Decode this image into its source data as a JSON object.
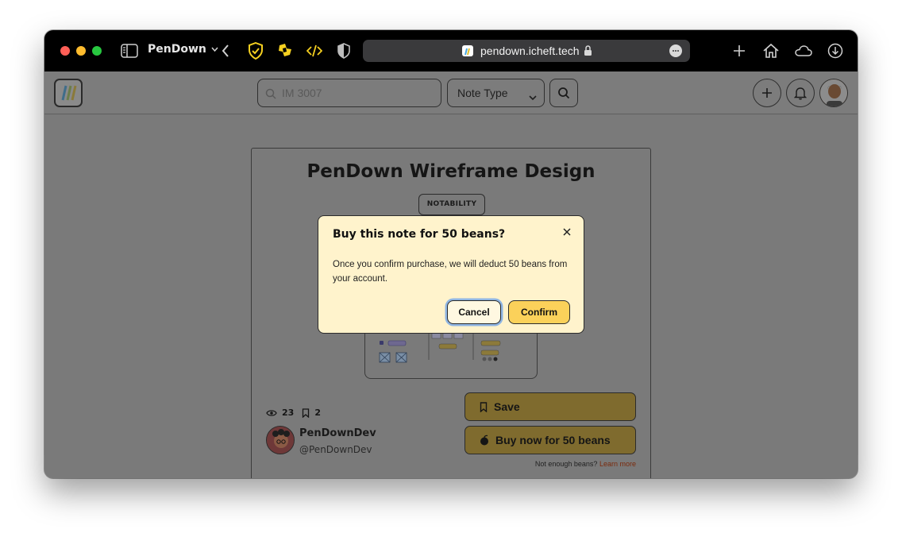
{
  "browser": {
    "tab_title": "PenDown",
    "url": "pendown.icheft.tech"
  },
  "header": {
    "search_placeholder": "IM 3007",
    "note_type_label": "Note Type"
  },
  "note": {
    "title": "PenDown Wireframe Design",
    "tag": "NOTABILITY",
    "views": "23",
    "saves": "2",
    "author_name": "PenDownDev",
    "author_handle": "@PenDownDev",
    "save_label": "Save",
    "buy_label": "Buy now for 50 beans",
    "beans_note": "Not enough beans?",
    "learn_more": "Learn more"
  },
  "modal": {
    "title": "Buy this note for 50 beans?",
    "body": "Once you confirm purchase, we will deduct 50 beans from your account.",
    "cancel_label": "Cancel",
    "confirm_label": "Confirm"
  },
  "colors": {
    "accent": "#fbd15a",
    "modal_bg": "#fff3cc",
    "focus_ring": "#8fb5e3"
  }
}
